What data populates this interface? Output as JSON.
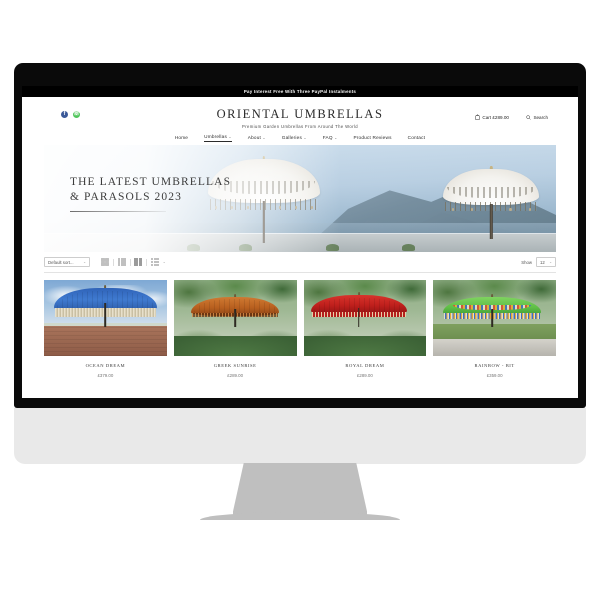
{
  "promo": {
    "text": "Pay Interest Free With Three PayPal Instalments"
  },
  "header": {
    "brand_title": "ORIENTAL UMBRELLAS",
    "brand_tagline": "Premium Garden Umbrellas From Around The World",
    "social": [
      {
        "name": "facebook-icon",
        "glyph": "f",
        "color": "#3b5998"
      },
      {
        "name": "whatsapp-icon",
        "glyph": "✆",
        "color": "#4fc65a"
      }
    ],
    "cart_label": "Cart £289.00",
    "search_label": "Search"
  },
  "nav": {
    "items": [
      {
        "label": "Home",
        "caret": "",
        "active": false
      },
      {
        "label": "Umbrellas",
        "caret": "⌄",
        "active": true
      },
      {
        "label": "About",
        "caret": "⌄",
        "active": false
      },
      {
        "label": "Galleries",
        "caret": "⌄",
        "active": false
      },
      {
        "label": "FAQ",
        "caret": "⌄",
        "active": false
      },
      {
        "label": "Product Reviews",
        "caret": "",
        "active": false
      },
      {
        "label": "Contact",
        "caret": "",
        "active": false
      }
    ]
  },
  "hero": {
    "line1": "THE LATEST UMBRELLAS",
    "line2": "& PARASOLS 2023"
  },
  "toolbar": {
    "sort_value": "Default sort...",
    "sort_caret": "⌄",
    "show_label": "Show",
    "show_value": "12",
    "show_caret": "⌄",
    "view_modes": [
      {
        "name": "view-grid-4-icon"
      },
      {
        "name": "view-grid-3-icon"
      },
      {
        "name": "view-grid-2-icon"
      },
      {
        "name": "view-list-icon"
      },
      {
        "name": "view-more-caret-icon",
        "caret": "⌄"
      }
    ]
  },
  "products": [
    {
      "title": "OCEAN DREAM",
      "price": "£379.00",
      "image_alt": "blue-umbrella-brick-wall"
    },
    {
      "title": "GREEK SUNRISE",
      "price": "£289.00",
      "image_alt": "orange-umbrella-garden"
    },
    {
      "title": "ROYAL DREAM",
      "price": "£289.00",
      "image_alt": "red-umbrella-garden"
    },
    {
      "title": "RAINBOW - BIT",
      "price": "£359.00",
      "image_alt": "green-rainbow-umbrella-lawn"
    }
  ],
  "colors": {
    "promo_bg": "#000000",
    "text_dark": "#2b2b2b",
    "text_muted": "#777777",
    "bezel": "#0a0a0a",
    "chin": "#e9e9e9",
    "stand": "#bfbfbf"
  }
}
